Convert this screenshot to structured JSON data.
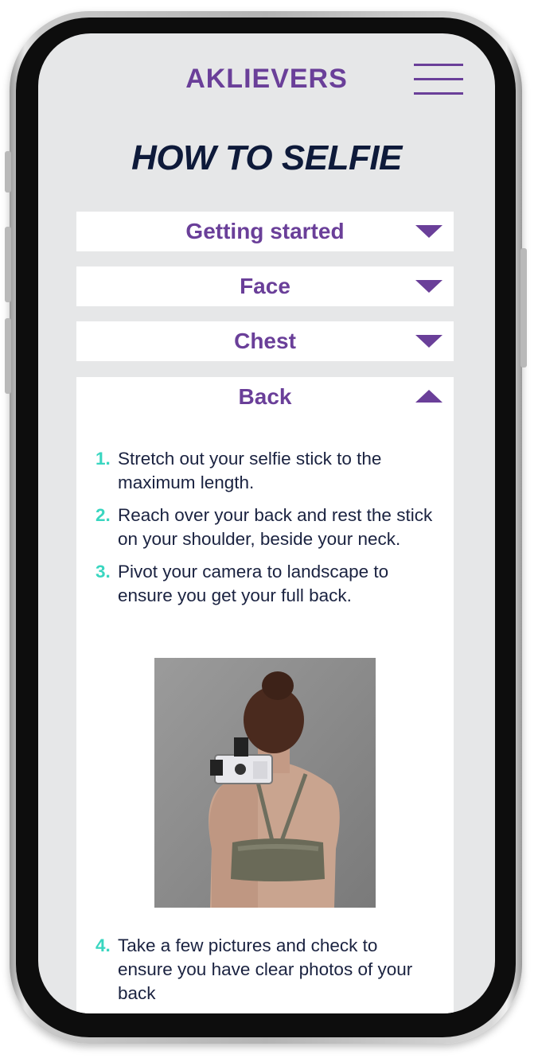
{
  "header": {
    "logo": "AKLIEVERS",
    "menu_icon": "hamburger-menu-icon"
  },
  "page": {
    "title": "HOW TO SELFIE"
  },
  "accordion": [
    {
      "label": "Getting started",
      "expanded": false,
      "icon": "chevron-down-icon"
    },
    {
      "label": "Face",
      "expanded": false,
      "icon": "chevron-down-icon"
    },
    {
      "label": "Chest",
      "expanded": false,
      "icon": "chevron-down-icon"
    },
    {
      "label": "Back",
      "expanded": true,
      "icon": "chevron-up-icon"
    }
  ],
  "back_section": {
    "steps": [
      {
        "num": "1.",
        "text": "Stretch out your selfie stick to the maximum length."
      },
      {
        "num": "2.",
        "text": "Reach over your back and rest the stick on your shoulder, beside your neck."
      },
      {
        "num": "3.",
        "text": "Pivot your camera to landscape to ensure you get your full back."
      }
    ],
    "steps_after_photo": [
      {
        "num": "4.",
        "text": "Take a few pictures and check to ensure you have clear photos of your back"
      }
    ]
  },
  "colors": {
    "brand_purple": "#6a3f99",
    "title_navy": "#0e1a3a",
    "accent_teal": "#39d6c0",
    "screen_bg": "#e6e7e8"
  }
}
